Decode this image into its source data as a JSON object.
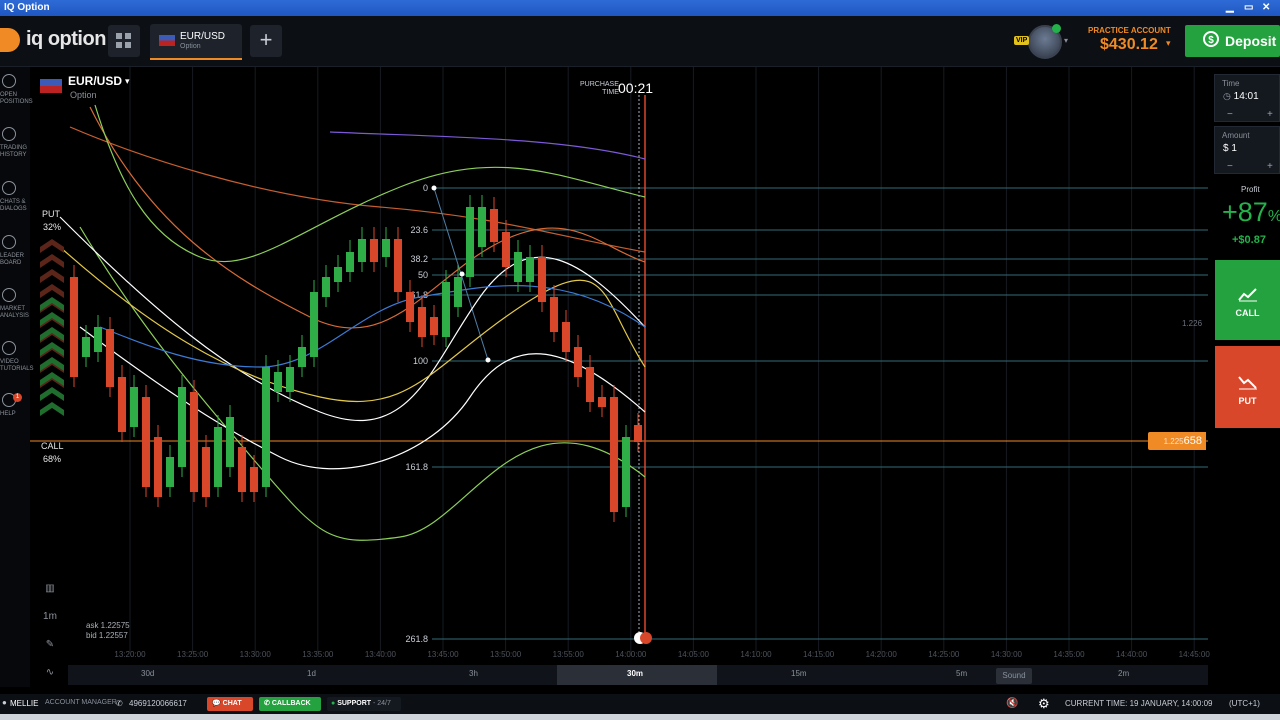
{
  "window": {
    "title": "IQ Option"
  },
  "header": {
    "logo_text": "iq option",
    "asset_tab": {
      "name": "EUR/USD",
      "sub": "Option"
    },
    "vip_badge": "VIP",
    "account": {
      "label": "PRACTICE ACCOUNT",
      "balance": "$430.12"
    },
    "deposit_label": "Deposit"
  },
  "sidebar": {
    "items": [
      {
        "label": "OPEN\nPOSITIONS",
        "icon": "arrows-updown-icon"
      },
      {
        "label": "TRADING\nHISTORY",
        "icon": "history-icon"
      },
      {
        "label": "CHATS &\nDIALOGS",
        "icon": "chat-icon"
      },
      {
        "label": "LEADER\nBOARD",
        "icon": "leaderboard-icon"
      },
      {
        "label": "MARKET\nANALYSIS",
        "icon": "analysis-icon"
      },
      {
        "label": "VIDEO\nTUTORIALS",
        "icon": "play-icon"
      },
      {
        "label": "HELP",
        "icon": "help-icon"
      }
    ],
    "help_badge": "1"
  },
  "chart_header": {
    "asset": "EUR/USD",
    "type": "Option",
    "purchase_label": "PURCHASE\nTIME",
    "purchase_time": "00:21"
  },
  "sentiment": {
    "put_label": "PUT",
    "put_pct": "32%",
    "call_label": "CALL",
    "call_pct": "68%"
  },
  "fibonacci": [
    "0",
    "23.6",
    "38.2",
    "50",
    "61.8",
    "100",
    "161.8",
    "261.8"
  ],
  "price": {
    "current_prefix": "1.225",
    "current_suffix": "658",
    "right_scale": "1.226"
  },
  "quote": {
    "ask": "ask 1.22575",
    "bid": "bid 1.22557"
  },
  "chart_tools": {
    "interval": "1m"
  },
  "x_ticks": [
    "13:20:00",
    "13:25:00",
    "13:30:00",
    "13:35:00",
    "13:40:00",
    "13:45:00",
    "13:50:00",
    "13:55:00",
    "14:00:00",
    "14:05:00",
    "14:10:00",
    "14:15:00",
    "14:20:00",
    "14:25:00",
    "14:30:00",
    "14:35:00",
    "14:40:00",
    "14:45:00"
  ],
  "timeframes": [
    "30d",
    "1d",
    "3h",
    "30m",
    "15m",
    "5m",
    "2m"
  ],
  "timeframe_selected": "30m",
  "right_panel": {
    "time_label": "Time",
    "time_value": "14:01",
    "amount_label": "Amount",
    "amount_value": "$ 1",
    "profit_label": "Profit",
    "profit_pct": "+87",
    "profit_pct_sign": "%",
    "profit_amount": "+$0.87",
    "call_label": "CALL",
    "put_label": "PUT"
  },
  "footer": {
    "user": "MELLIE",
    "manager_label": "ACCOUNT MANAGER",
    "phone": "4969120066617",
    "chat": "CHAT",
    "callback": "CALLBACK",
    "support": "SUPPORT",
    "support_hours": "- 24/7",
    "sound": "Sound",
    "current_time": "CURRENT TIME: 19 JANUARY, 14:00:09",
    "timezone": "(UTC+1)"
  },
  "colors": {
    "accent": "#f08a24",
    "call": "#24a23f",
    "put": "#d9472b",
    "bull": "#2fae48",
    "bear": "#d9472b"
  }
}
